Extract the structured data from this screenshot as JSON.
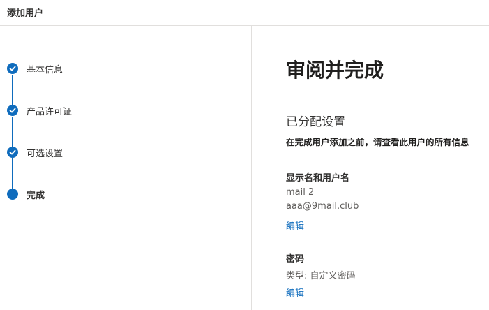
{
  "header": {
    "title": "添加用户"
  },
  "steps": [
    {
      "label": "基本信息",
      "state": "done"
    },
    {
      "label": "产品许可证",
      "state": "done"
    },
    {
      "label": "可选设置",
      "state": "done"
    },
    {
      "label": "完成",
      "state": "current"
    }
  ],
  "main": {
    "page_title": "审阅并完成",
    "section_title": "已分配设置",
    "lead_text": "在完成用户添加之前，请查看此用户的所有信息",
    "display_name": {
      "title": "显示名和用户名",
      "name": "mail 2",
      "username": "aaa@9mail.club",
      "edit_label": "编辑"
    },
    "password": {
      "title": "密码",
      "type_text": "类型: 自定义密码",
      "edit_label": "编辑"
    }
  },
  "colors": {
    "accent": "#0f6cbd",
    "divider": "#e1dfdd"
  }
}
